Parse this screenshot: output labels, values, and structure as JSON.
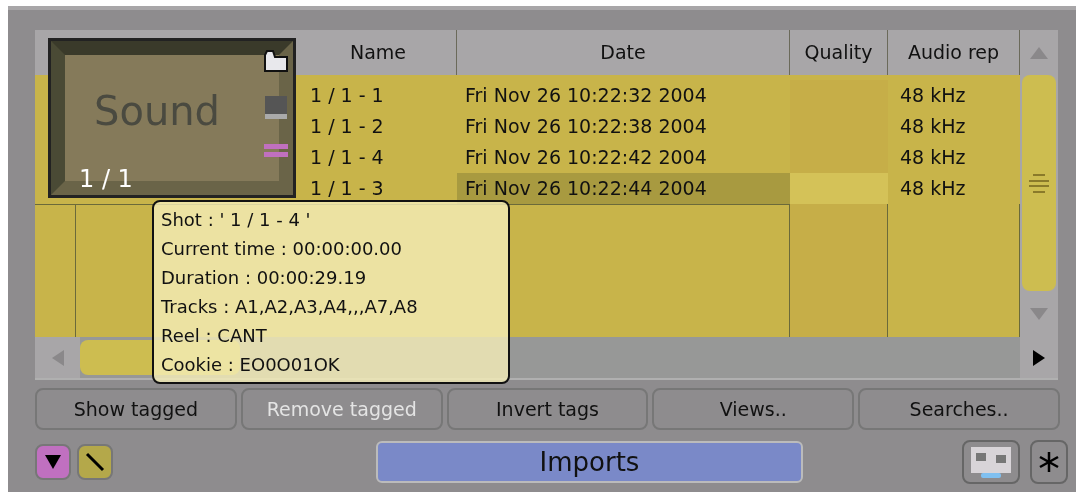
{
  "table": {
    "columns": [
      "Name",
      "Date",
      "Quality",
      "Audio rep"
    ],
    "rows": [
      {
        "name": "1 / 1 - 1",
        "date": "Fri Nov 26 10:22:32 2004",
        "audio": "48 kHz",
        "selected": false
      },
      {
        "name": "1 / 1 - 2",
        "date": "Fri Nov 26 10:22:38 2004",
        "audio": "48 kHz",
        "selected": false
      },
      {
        "name": "1 / 1 - 4",
        "date": "Fri Nov 26 10:22:42 2004",
        "audio": "48 kHz",
        "selected": false
      },
      {
        "name": "1 / 1 - 3",
        "date": "Fri Nov 26 10:22:44 2004",
        "audio": "48 kHz",
        "selected": true
      }
    ]
  },
  "thumbnail": {
    "title": "Sound",
    "label": "1 / 1"
  },
  "tooltip": {
    "lines": [
      "Shot : ' 1 / 1 - 4 '",
      "Current time : 00:00:00.00",
      "Duration : 00:00:29.19",
      "Tracks : A1,A2,A3,A4,,,A7,A8",
      "Reel : CANT",
      "Cookie : EO0O01OK"
    ]
  },
  "buttons": [
    {
      "label": "Show tagged",
      "disabled": false
    },
    {
      "label": "Remove tagged",
      "disabled": true
    },
    {
      "label": "Invert tags",
      "disabled": false
    },
    {
      "label": "Views..",
      "disabled": false
    },
    {
      "label": "Searches..",
      "disabled": false
    }
  ],
  "bin_name": "Imports"
}
